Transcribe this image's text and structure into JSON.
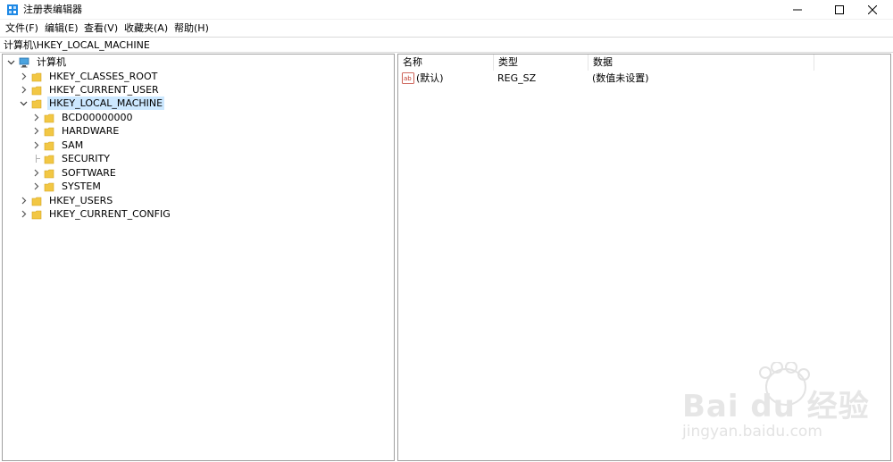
{
  "window": {
    "title": "注册表编辑器"
  },
  "menu": [
    "文件(F)",
    "编辑(E)",
    "查看(V)",
    "收藏夹(A)",
    "帮助(H)"
  ],
  "address": "计算机\\HKEY_LOCAL_MACHINE",
  "tree": {
    "root": "计算机",
    "hives": [
      "HKEY_CLASSES_ROOT",
      "HKEY_CURRENT_USER",
      "HKEY_LOCAL_MACHINE",
      "HKEY_USERS",
      "HKEY_CURRENT_CONFIG"
    ],
    "local_machine_children": [
      "BCD00000000",
      "HARDWARE",
      "SAM",
      "SECURITY",
      "SOFTWARE",
      "SYSTEM"
    ],
    "selected": "HKEY_LOCAL_MACHINE"
  },
  "list": {
    "columns": [
      "名称",
      "类型",
      "数据"
    ],
    "rows": [
      {
        "name": "(默认)",
        "type": "REG_SZ",
        "data": "(数值未设置)"
      }
    ]
  },
  "watermark": {
    "brand": "Bai du 经验",
    "url": "jingyan.baidu.com"
  },
  "colors": {
    "selection": "#cce8ff",
    "folder": "#f2c744",
    "border": "#a0a0a0"
  }
}
